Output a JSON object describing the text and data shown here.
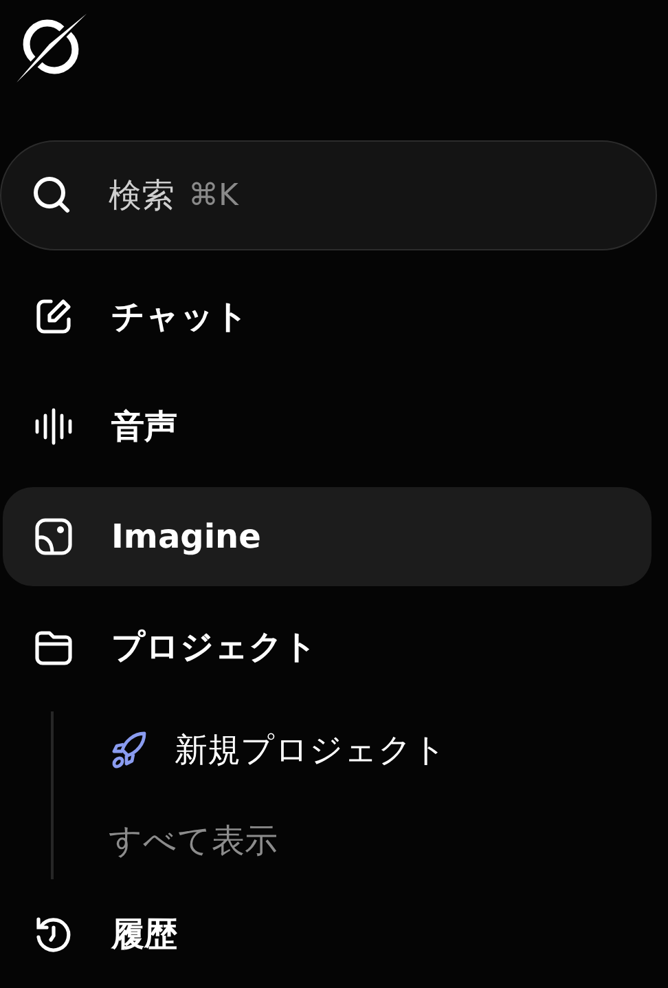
{
  "search": {
    "placeholder": "検索",
    "shortcut": "⌘K"
  },
  "nav": [
    {
      "label": "チャット",
      "kind": "chat",
      "selected": false
    },
    {
      "label": "音声",
      "kind": "voice",
      "selected": false
    },
    {
      "label": "Imagine",
      "kind": "imagine",
      "selected": true
    },
    {
      "label": "プロジェクト",
      "kind": "projects",
      "selected": false,
      "children": [
        {
          "label": "新規プロジェクト",
          "kind": "new"
        },
        {
          "label": "すべて表示",
          "kind": "all"
        }
      ]
    },
    {
      "label": "履歴",
      "kind": "history",
      "selected": false
    }
  ]
}
